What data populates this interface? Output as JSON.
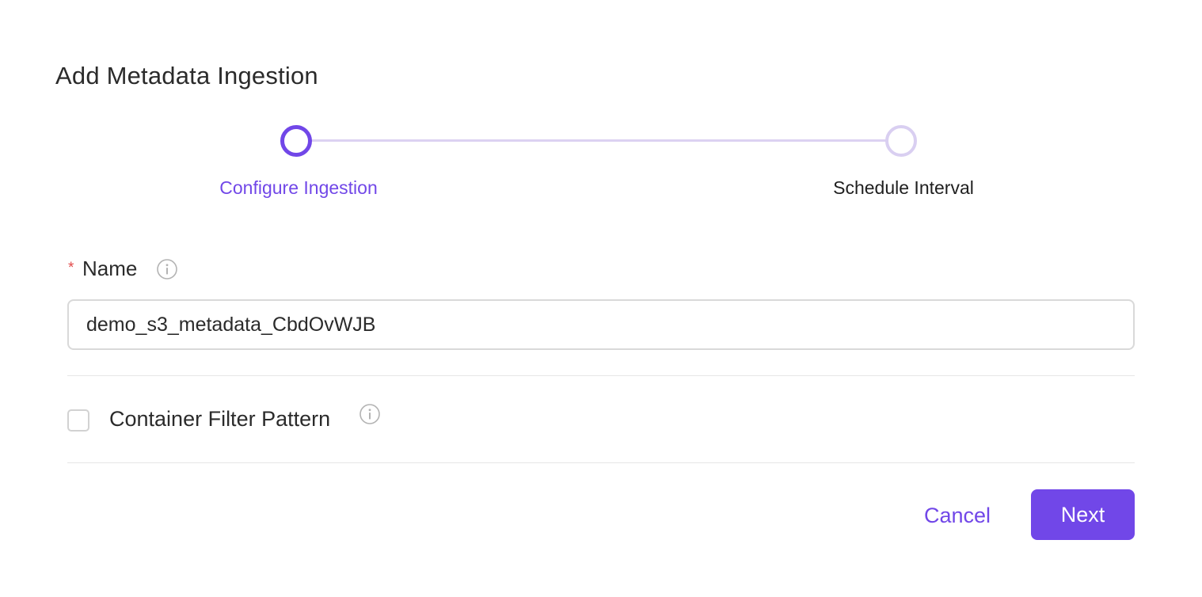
{
  "page": {
    "title": "Add Metadata Ingestion"
  },
  "stepper": {
    "steps": [
      {
        "label": "Configure Ingestion",
        "state": "active"
      },
      {
        "label": "Schedule Interval",
        "state": "inactive"
      }
    ]
  },
  "form": {
    "name": {
      "required_mark": "*",
      "label": "Name",
      "value": "demo_s3_metadata_CbdOvWJB",
      "info_icon": "info-circle-icon"
    },
    "container_filter": {
      "label": "Container Filter Pattern",
      "checked": false,
      "info_icon": "info-circle-icon"
    }
  },
  "actions": {
    "cancel_label": "Cancel",
    "next_label": "Next"
  },
  "colors": {
    "accent": "#7147e8",
    "stepper_inactive": "#d9cff1",
    "required": "#e24a4a"
  }
}
